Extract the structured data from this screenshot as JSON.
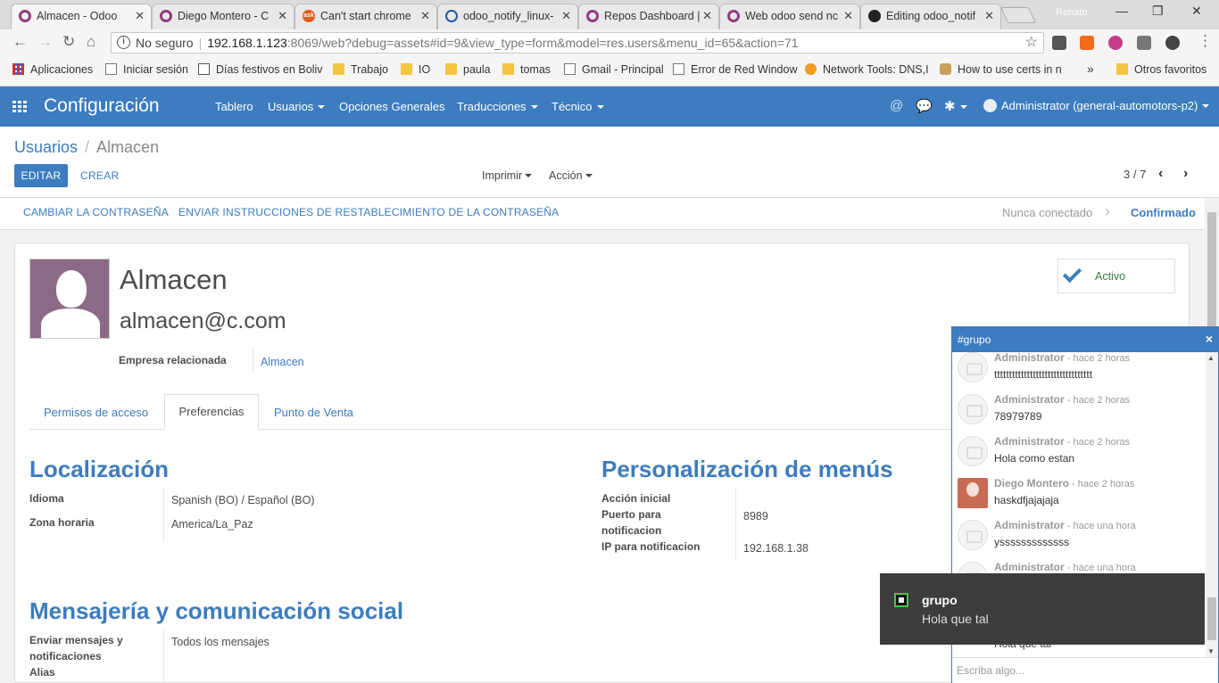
{
  "browser": {
    "tabs": [
      {
        "label": "Almacen - Odoo",
        "icon": "odoo-icon"
      },
      {
        "label": "Diego Montero - C",
        "icon": "odoo-icon"
      },
      {
        "label": "Can't start chrome",
        "icon": "askubuntu-icon"
      },
      {
        "label": "odoo_notify_linux-",
        "icon": "fingerprint-icon"
      },
      {
        "label": "Repos Dashboard |",
        "icon": "odoo-icon"
      },
      {
        "label": "Web odoo send nc",
        "icon": "odoo-icon"
      },
      {
        "label": "Editing odoo_notif",
        "icon": "github-icon"
      }
    ],
    "profile_name": "Renato",
    "url_security": "No seguro",
    "url_host": "192.168.1.123",
    "url_path": ":8069/web?debug=assets#id=9&view_type=form&model=res.users&menu_id=65&action=71",
    "bookmarks": [
      {
        "label": "Aplicaciones",
        "icon": "apps"
      },
      {
        "label": "Iniciar sesión",
        "icon": "page"
      },
      {
        "label": "Días festivos en Boliv",
        "icon": "cal"
      },
      {
        "label": "Trabajo",
        "icon": "folder"
      },
      {
        "label": "IO",
        "icon": "folder"
      },
      {
        "label": "paula",
        "icon": "folder"
      },
      {
        "label": "tomas",
        "icon": "folder"
      },
      {
        "label": "Gmail - Principal",
        "icon": "page"
      },
      {
        "label": "Error de Red Window",
        "icon": "page"
      },
      {
        "label": "Network Tools: DNS,I",
        "icon": "x"
      },
      {
        "label": "How to use certs in n",
        "icon": "horse"
      }
    ],
    "bookmarks_more": "»",
    "other_bookmarks": "Otros favoritos"
  },
  "odoo": {
    "app_title": "Configuración",
    "menus": [
      "Tablero",
      "Usuarios",
      "Opciones Generales",
      "Traducciones",
      "Técnico"
    ],
    "user_label": "Administrator (general-automotors-p2)"
  },
  "control": {
    "breadcrumb_root": "Usuarios",
    "breadcrumb_current": "Almacen",
    "edit_label": "EDITAR",
    "create_label": "CREAR",
    "print_label": "Imprimir",
    "action_label": "Acción",
    "pager": "3 / 7"
  },
  "statusbar": {
    "change_password": "CAMBIAR LA CONTRASEÑA",
    "send_reset": "ENVIAR INSTRUCCIONES DE RESTABLECIMIENTO DE LA CONTRASEÑA",
    "stage_never": "Nunca conectado",
    "stage_confirmed": "Confirmado"
  },
  "form": {
    "name": "Almacen",
    "email": "almacen@c.com",
    "company_label": "Empresa relacionada",
    "company_value": "Almacen",
    "active_label": "Activo",
    "tabs": [
      "Permisos de acceso",
      "Preferencias",
      "Punto de Venta"
    ],
    "localization": {
      "title": "Localización",
      "lang_label": "Idioma",
      "lang_value": "Spanish (BO) / Español (BO)",
      "tz_label": "Zona horaria",
      "tz_value": "America/La_Paz"
    },
    "menus_section": {
      "title": "Personalización de menús",
      "home_action_label": "Acción inicial",
      "notify_port_label_1": "Puerto para",
      "notify_port_label_2": "notificacion",
      "notify_port_value": "8989",
      "notify_ip_label": "IP para notificacion",
      "notify_ip_value": "192.168.1.38"
    },
    "messaging": {
      "title": "Mensajería y comunicación social",
      "send_label_1": "Enviar mensajes y",
      "send_label_2": "notificaciones",
      "send_value": "Todos los mensajes",
      "alias_label": "Alias"
    }
  },
  "chat": {
    "title": "#grupo",
    "close": "×",
    "messages": [
      {
        "author": "Administrator",
        "when": " - hace 2 horas",
        "body": "ttttttttttttttttttttttttttttttttt"
      },
      {
        "author": "Administrator",
        "when": " - hace 2 horas",
        "body": "78979789"
      },
      {
        "author": "Administrator",
        "when": " - hace 2 horas",
        "body": "Hola como estan"
      },
      {
        "author": "Diego Montero",
        "when": " - hace 2 horas",
        "body": "haskdfjajajaja"
      },
      {
        "author": "Administrator",
        "when": " - hace una hora",
        "body": "ysssssssssssss"
      },
      {
        "author": "Administrator",
        "when": " - hace una hora",
        "body": "Hola que tal"
      }
    ],
    "compose_placeholder": "Escriba algo..."
  },
  "toast": {
    "title": "grupo",
    "body": "Hola que tal"
  }
}
